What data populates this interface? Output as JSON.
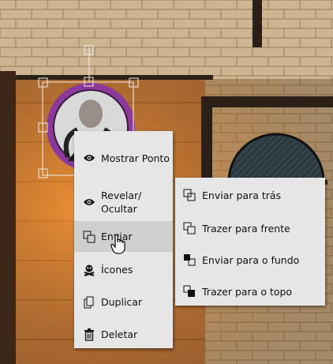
{
  "context_menu": {
    "items": [
      {
        "label": "Mostrar Ponto",
        "icon": "eye-icon"
      },
      {
        "label": "Revelar/ Ocultar",
        "icon": "eye-icon"
      },
      {
        "label": "Enviar",
        "icon": "layers-icon"
      },
      {
        "label": "Ícones",
        "icon": "skull-crossbones-icon"
      },
      {
        "label": "Duplicar",
        "icon": "copy-icon"
      },
      {
        "label": "Deletar",
        "icon": "trash-icon"
      }
    ]
  },
  "submenu": {
    "items": [
      {
        "label": "Enviar para trás",
        "icon": "send-backward-icon"
      },
      {
        "label": "Trazer para frente",
        "icon": "bring-forward-icon"
      },
      {
        "label": "Enviar para o fundo",
        "icon": "send-to-back-icon"
      },
      {
        "label": "Trazer para o topo",
        "icon": "bring-to-front-icon"
      }
    ]
  },
  "colors": {
    "menu_bg": "#e6e6e6",
    "hover_bg": "#cfcfcf",
    "token_ring": "#7a2a8a"
  }
}
